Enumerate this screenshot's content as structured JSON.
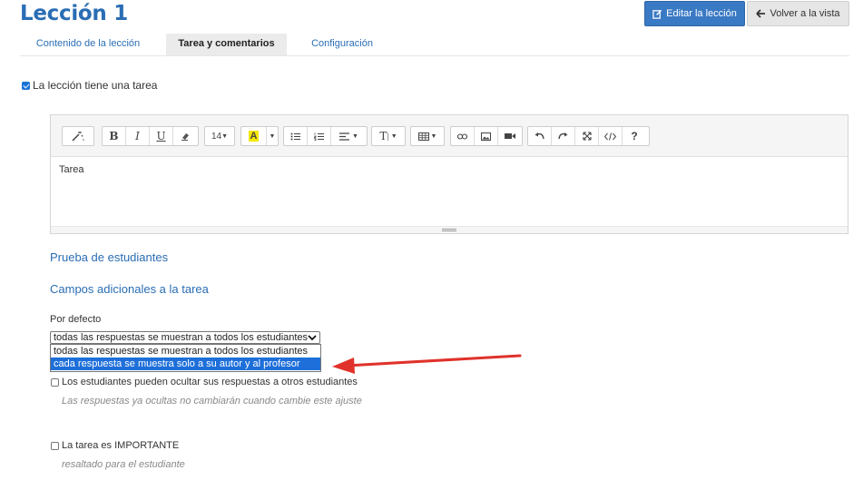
{
  "header": {
    "title": "Lección 1",
    "edit_button": "Editar la lección",
    "back_button": "Volver a la vista"
  },
  "tabs": [
    {
      "label": "Contenido de la lección",
      "active": false
    },
    {
      "label": "Tarea y comentarios",
      "active": true
    },
    {
      "label": "Configuración",
      "active": false
    }
  ],
  "has_task": {
    "label": "La lección tiene una tarea",
    "checked": true
  },
  "editor": {
    "content": "Tarea",
    "toolbar": {
      "font_size": "14",
      "highlight_letter": "A",
      "text_style_letter": "T",
      "bold": "B",
      "italic": "I",
      "underline": "U",
      "help": "?"
    }
  },
  "sections": {
    "student_test": "Prueba de estudiantes",
    "extra_fields": "Campos adicionales a la tarea"
  },
  "default_select": {
    "label": "Por defecto",
    "value": "todas las respuestas se muestran a todos los estudiantes",
    "options": [
      "todas las respuestas se muestran a todos los estudiantes",
      "cada respuesta se muestra solo a su autor y al profesor"
    ],
    "highlighted_index": 1
  },
  "hide_answers": {
    "label": "Los estudiantes pueden ocultar sus respuestas a otros estudiantes",
    "hint": "Las respuestas ya ocultas no cambiarán cuando cambie este ajuste",
    "checked": false
  },
  "important": {
    "label": "La tarea es IMPORTANTE",
    "hint": "resaltado para el estudiante",
    "checked": false
  },
  "colors": {
    "accent": "#2a6db4",
    "selection": "#1e6fd9",
    "annotation_arrow": "#e0322b",
    "highlight_yellow": "#f5e600"
  }
}
